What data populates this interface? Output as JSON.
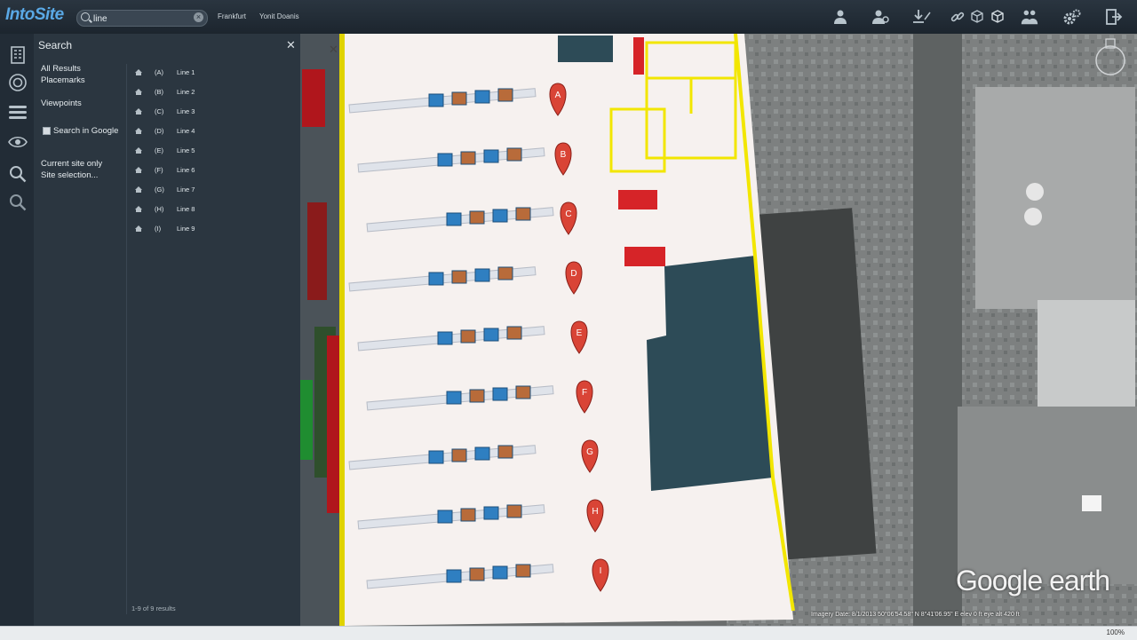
{
  "app": {
    "logo": "IntoSite"
  },
  "search": {
    "query": "line"
  },
  "breadcrumb": {
    "site": "Frankfurt",
    "location": "Yonit Doanis"
  },
  "toolbar": {
    "icons": [
      "user-icon",
      "user-settings-icon",
      "download-icon",
      "link-icon",
      "cube-outline-icon",
      "cube-icon",
      "people-icon",
      "gear-icon",
      "exit-icon"
    ]
  },
  "panel": {
    "title": "Search",
    "categories": [
      "All Results",
      "Placemarks",
      "Viewpoints"
    ],
    "checkbox": "Search in Google",
    "scopes": [
      "Current site only",
      "Site selection..."
    ],
    "footer": "1-9 of 9 results",
    "results": [
      {
        "letter": "(A)",
        "name": "Line 1"
      },
      {
        "letter": "(B)",
        "name": "Line 2"
      },
      {
        "letter": "(C)",
        "name": "Line 3"
      },
      {
        "letter": "(D)",
        "name": "Line 4"
      },
      {
        "letter": "(E)",
        "name": "Line 5"
      },
      {
        "letter": "(F)",
        "name": "Line 6"
      },
      {
        "letter": "(G)",
        "name": "Line 7"
      },
      {
        "letter": "(H)",
        "name": "Line 8"
      },
      {
        "letter": "(I)",
        "name": "Line 9"
      }
    ]
  },
  "map": {
    "markers": [
      "A",
      "B",
      "C",
      "D",
      "E",
      "F",
      "G",
      "H",
      "I"
    ],
    "brand": "Google earth",
    "imagery": "Imagery Date: 8/1/2013     50°06'54.58\" N    8°41'06.95\" E  elev   0 ft   eye alt  420 ft"
  },
  "status": {
    "zoom": "100%"
  },
  "colors": {
    "accent": "#5aa9e6",
    "marker": "#d94436",
    "equipment": "#2f7fc1",
    "highlight": "#f2e600"
  }
}
